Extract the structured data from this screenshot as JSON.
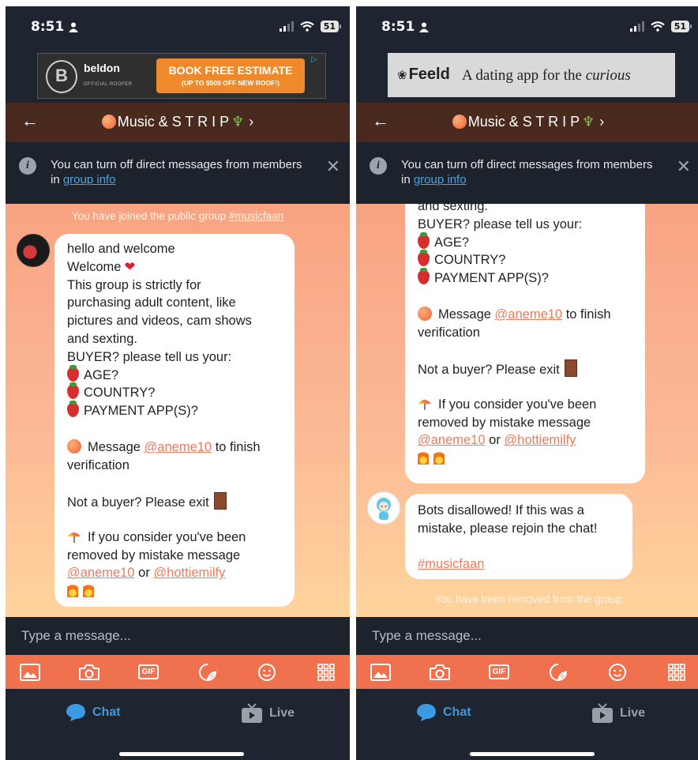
{
  "status": {
    "time": "8:51",
    "battery": "51"
  },
  "ads": {
    "left": {
      "brand": "beldon",
      "subtitle": "OFFICIAL ROOFER",
      "cta": "BOOK FREE ESTIMATE",
      "cta_sub": "(UP TO $500 OFF NEW ROOF!)"
    },
    "right": {
      "brand": "Feeld",
      "tagline_prefix": "A dating app for the ",
      "tagline_emphasis": "curious"
    }
  },
  "header": {
    "title": "Music & S T R I P",
    "back_icon": "arrow-left-icon",
    "chevron": "›"
  },
  "notice": {
    "text": "You can turn off direct messages from members in ",
    "link": "group info",
    "close_icon": "close-icon"
  },
  "left": {
    "system_joined_prefix": "You have joined the public group ",
    "system_joined_tag": "#musicfaan",
    "bubble_lines": {
      "l1": "hello and welcome",
      "l2": "Welcome",
      "l3": "This group is strictly for",
      "l4": "purchasing adult content, like",
      "l5": "pictures and videos, cam shows",
      "l6": "and sexting.",
      "l7": "BUYER? please tell us your:",
      "age": "AGE?",
      "country": "COUNTRY?",
      "payment": "PAYMENT APP(S)?",
      "msg_prefix": "Message ",
      "mention1": "@aneme10",
      "msg_suffix": " to finish",
      "verification": "verification",
      "not_buyer": "Not a buyer? Please exit",
      "consider": "If you consider you've been",
      "removed": "removed by mistake message",
      "or": " or ",
      "mention2": "@hottiemilfy"
    }
  },
  "right": {
    "bubble_lines": {
      "l6": "and sexting.",
      "l7": "BUYER? please tell us your:",
      "age": "AGE?",
      "country": "COUNTRY?",
      "payment": "PAYMENT APP(S)?",
      "msg_prefix": "Message ",
      "mention1": "@aneme10",
      "msg_suffix": " to finish",
      "verification": "verification",
      "not_buyer": "Not a buyer? Please exit",
      "consider": "If you consider you've been",
      "removed": "removed by mistake message",
      "or": " or ",
      "mention2": "@hottiemilfy"
    },
    "bot_lines": {
      "l1": "Bots disallowed! If this was a",
      "l2": "mistake, please rejoin the chat!",
      "tag": "#musicfaan"
    },
    "system_removed": "You have been removed from the group"
  },
  "input": {
    "placeholder": "Type a message..."
  },
  "toolbar": {
    "gif_label": "GIF",
    "icons": [
      "image-icon",
      "camera-icon",
      "gif-icon",
      "sticker-icon",
      "emoji-icon",
      "grid-icon"
    ]
  },
  "nav": {
    "chat": "Chat",
    "live": "Live"
  },
  "colors": {
    "accent": "#f0714e",
    "link": "#4aa3df",
    "mention": "#ef7a5c",
    "header": "#4a2a1e"
  }
}
